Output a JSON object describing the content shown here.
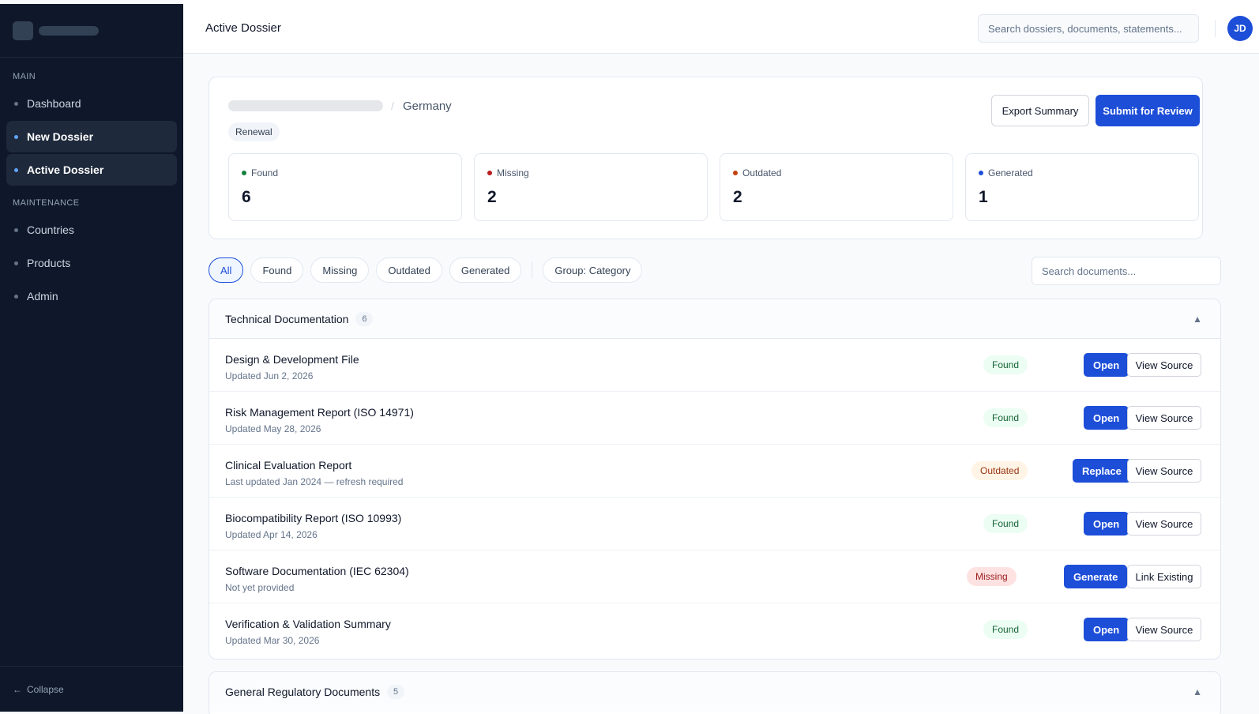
{
  "sidebar": {
    "sections": {
      "main": "MAIN",
      "maintenance": "MAINTENANCE"
    },
    "main_items": [
      {
        "label": "Dashboard"
      },
      {
        "label": "New Dossier"
      },
      {
        "label": "Active Dossier"
      }
    ],
    "maintenance_items": [
      {
        "label": "Countries"
      },
      {
        "label": "Products"
      },
      {
        "label": "Admin"
      }
    ],
    "collapse": {
      "icon": "←",
      "label": "Collapse"
    }
  },
  "header": {
    "title": "Active Dossier",
    "search_placeholder": "Search dossiers, documents, statements...",
    "avatar_initials": "JD"
  },
  "dossier": {
    "separator": "/",
    "country": "Germany",
    "tag": "Renewal",
    "export_label": "Export Summary",
    "submit_label": "Submit for Review",
    "stats": [
      {
        "label": "Found",
        "value": "6",
        "color": "#15803d"
      },
      {
        "label": "Missing",
        "value": "2",
        "color": "#b91c1c"
      },
      {
        "label": "Outdated",
        "value": "2",
        "color": "#c2410c"
      },
      {
        "label": "Generated",
        "value": "1",
        "color": "#1d4ed8"
      }
    ]
  },
  "filters": {
    "chips": [
      "All",
      "Found",
      "Missing",
      "Outdated",
      "Generated"
    ],
    "group_label": "Group: Category",
    "search_placeholder": "Search documents..."
  },
  "groups": [
    {
      "title": "Technical Documentation",
      "count": "6",
      "chevron": "▲",
      "rows": [
        {
          "name": "Design & Development File",
          "sub": "Updated Jun 2, 2026",
          "status": "Found",
          "primary": "Open",
          "secondary": "View Source"
        },
        {
          "name": "Risk Management Report (ISO 14971)",
          "sub": "Updated May 28, 2026",
          "status": "Found",
          "primary": "Open",
          "secondary": "View Source"
        },
        {
          "name": "Clinical Evaluation Report",
          "sub": "Last updated Jan 2024 — refresh required",
          "status": "Outdated",
          "primary": "Replace",
          "secondary": "View Source"
        },
        {
          "name": "Biocompatibility Report (ISO 10993)",
          "sub": "Updated Apr 14, 2026",
          "status": "Found",
          "primary": "Open",
          "secondary": "View Source"
        },
        {
          "name": "Software Documentation (IEC 62304)",
          "sub": "Not yet provided",
          "status": "Missing",
          "primary": "Generate",
          "secondary": "Link Existing"
        },
        {
          "name": "Verification & Validation Summary",
          "sub": "Updated Mar 30, 2026",
          "status": "Found",
          "primary": "Open",
          "secondary": "View Source"
        }
      ]
    },
    {
      "title": "General Regulatory Documents",
      "count": "5",
      "chevron": "▲"
    }
  ]
}
